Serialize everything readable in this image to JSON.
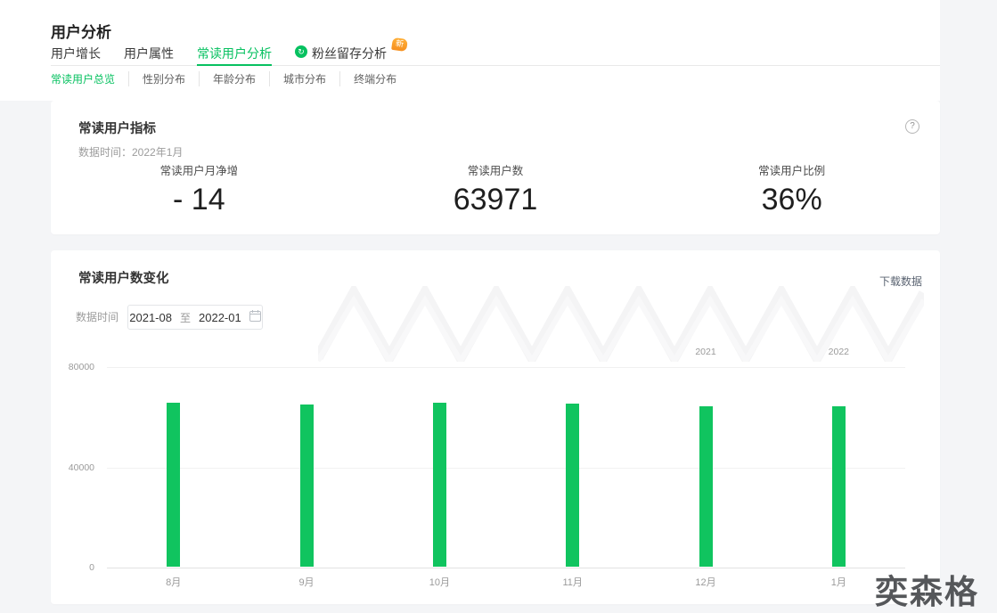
{
  "page": {
    "title": "用户分析",
    "watermark": "奕森格",
    "accent_color": "#07C160",
    "background_color": "#F4F5F7"
  },
  "tabs": {
    "items": [
      {
        "label": "用户增长",
        "active": false
      },
      {
        "label": "用户属性",
        "active": false
      },
      {
        "label": "常读用户分析",
        "active": true
      },
      {
        "label": "粉丝留存分析",
        "active": false,
        "icon": "retention-circle-icon",
        "badge": "新"
      }
    ]
  },
  "subtabs": {
    "items": [
      "常读用户总览",
      "性别分布",
      "年龄分布",
      "城市分布",
      "终端分布"
    ],
    "active_index": 0
  },
  "metrics_card": {
    "title": "常读用户指标",
    "data_time": "数据时间：2022年1月",
    "help_icon": "question-mark",
    "metrics": [
      {
        "label": "常读用户月净增",
        "value": "- 14"
      },
      {
        "label": "常读用户数",
        "value": "63971"
      },
      {
        "label": "常读用户比例",
        "value": "36%"
      }
    ]
  },
  "chart_card": {
    "title": "常读用户数变化",
    "download_label": "下载数据",
    "data_time_label": "数据时间",
    "date_range": {
      "start": "2021-08",
      "separator": "至",
      "end": "2022-01"
    },
    "calendar_icon": "calendar"
  },
  "chart_data": {
    "type": "bar",
    "title": "常读用户数变化",
    "categories": [
      "8月",
      "9月",
      "10月",
      "11月",
      "12月",
      "1月"
    ],
    "values": [
      65300,
      64700,
      65500,
      65000,
      63985,
      63971
    ],
    "year_labels": [
      {
        "text": "2021",
        "slot": 4
      },
      {
        "text": "2022",
        "slot": 5
      }
    ],
    "ylim": [
      0,
      80000
    ],
    "yticks": [
      0,
      40000,
      80000
    ],
    "bar_color": "#10C45F",
    "grid": true,
    "legend": "none"
  }
}
